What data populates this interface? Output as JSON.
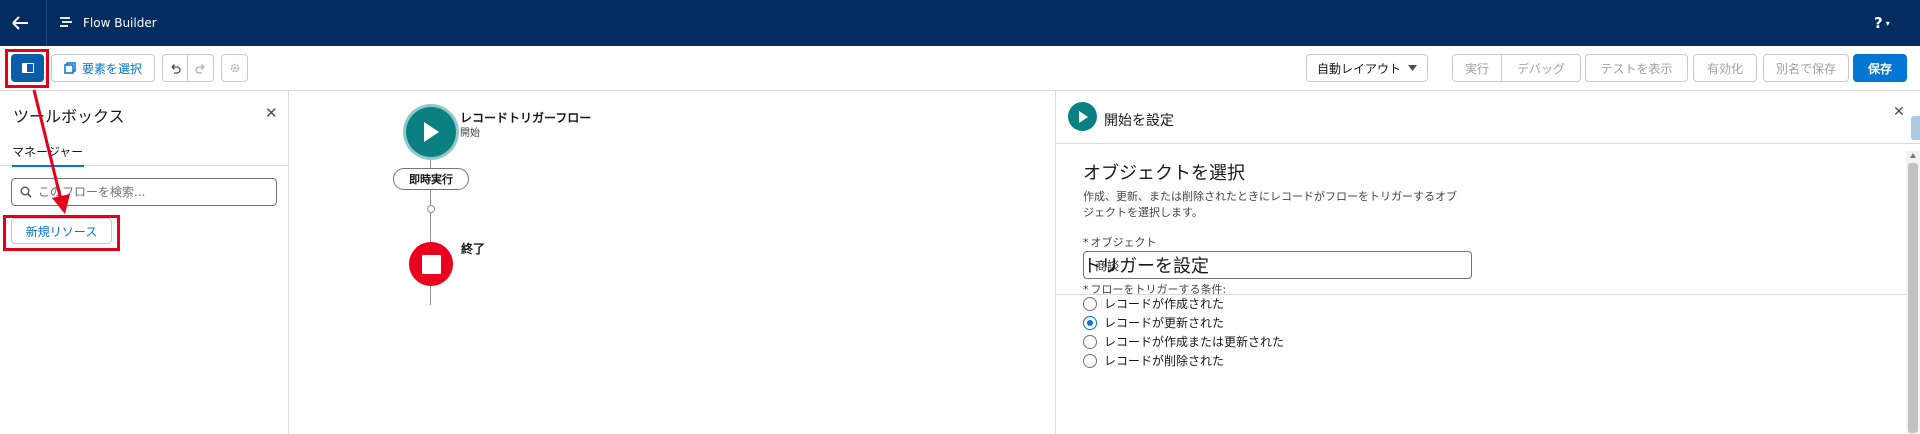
{
  "topbar": {
    "app_title": "Flow Builder",
    "help_label": "?",
    "help_caret": "▾"
  },
  "toolbar": {
    "select_elements_label": "要素を選択",
    "auto_layout_label": "自動レイアウト",
    "run_label": "実行",
    "debug_label": "デバッグ",
    "show_tests_label": "テストを表示",
    "activate_label": "有効化",
    "save_as_label": "別名で保存",
    "save_label": "保存"
  },
  "toolbox": {
    "title": "ツールボックス",
    "close_glyph": "✕",
    "tab_manager": "マネージャー",
    "search_placeholder": "このフローを検索...",
    "new_resource_label": "新規リソース"
  },
  "canvas": {
    "start_title": "レコードトリガーフロー",
    "start_subtitle": "開始",
    "path_label": "即時実行",
    "end_label": "終了"
  },
  "panel": {
    "title": "開始を設定",
    "close_glyph": "✕",
    "object_section_title": "オブジェクトを選択",
    "object_section_desc": "作成、更新、または削除されたときにレコードがフローをトリガーするオブジェクトを選択します。",
    "object_required_mark": "*",
    "object_label": "オブジェクト",
    "object_value": "商談",
    "trigger_section_title": "トリガーを設定",
    "trigger_required_mark": "*",
    "trigger_label": "フローをトリガーする条件:",
    "trigger_options": [
      "レコードが作成された",
      "レコードが更新された",
      "レコードが作成または更新された",
      "レコードが削除された"
    ],
    "trigger_selected_index": 1
  },
  "colors": {
    "header_bg": "#032d60",
    "brand_blue": "#0176d3",
    "start_node": "#0a8082",
    "end_node": "#ea001e",
    "annotation_red": "#e3001b"
  }
}
